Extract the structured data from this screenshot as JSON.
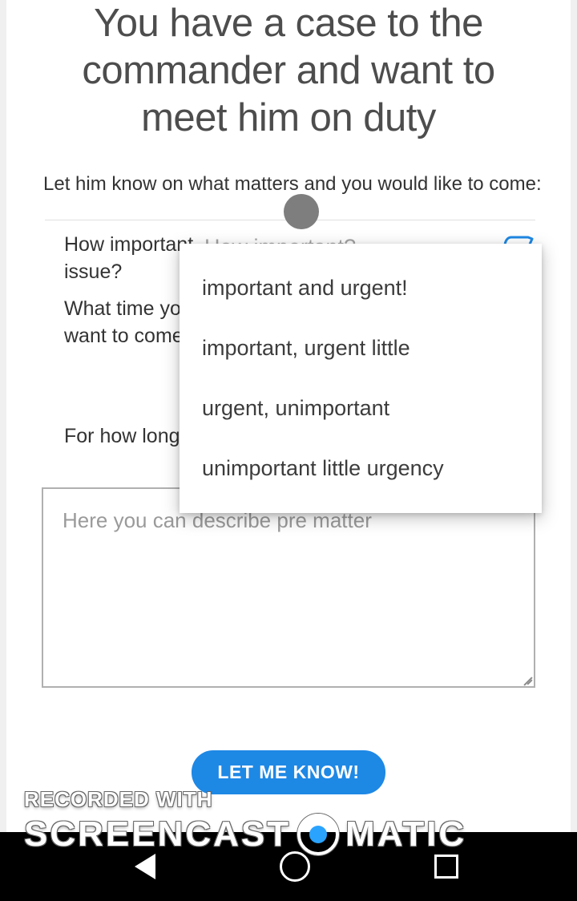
{
  "heading": "You have a case to the commander and want to meet him on duty",
  "subtext": "Let him know on what matters and you would like to come:",
  "form": {
    "importance": {
      "label": "How important issue?",
      "placeholder": "How important?",
      "options": [
        "important and urgent!",
        "important, urgent little",
        "urgent, unimportant",
        "unimportant little urgency"
      ]
    },
    "time": {
      "label": "What time you want to come?"
    },
    "duration": {
      "label": "For how long?"
    },
    "description_placeholder": "Here you can describe pre matter"
  },
  "submit_label": "LET ME KNOW!",
  "watermark": {
    "line1": "RECORDED WITH",
    "line2a": "SCREENCAST",
    "line2b": "MATIC"
  }
}
